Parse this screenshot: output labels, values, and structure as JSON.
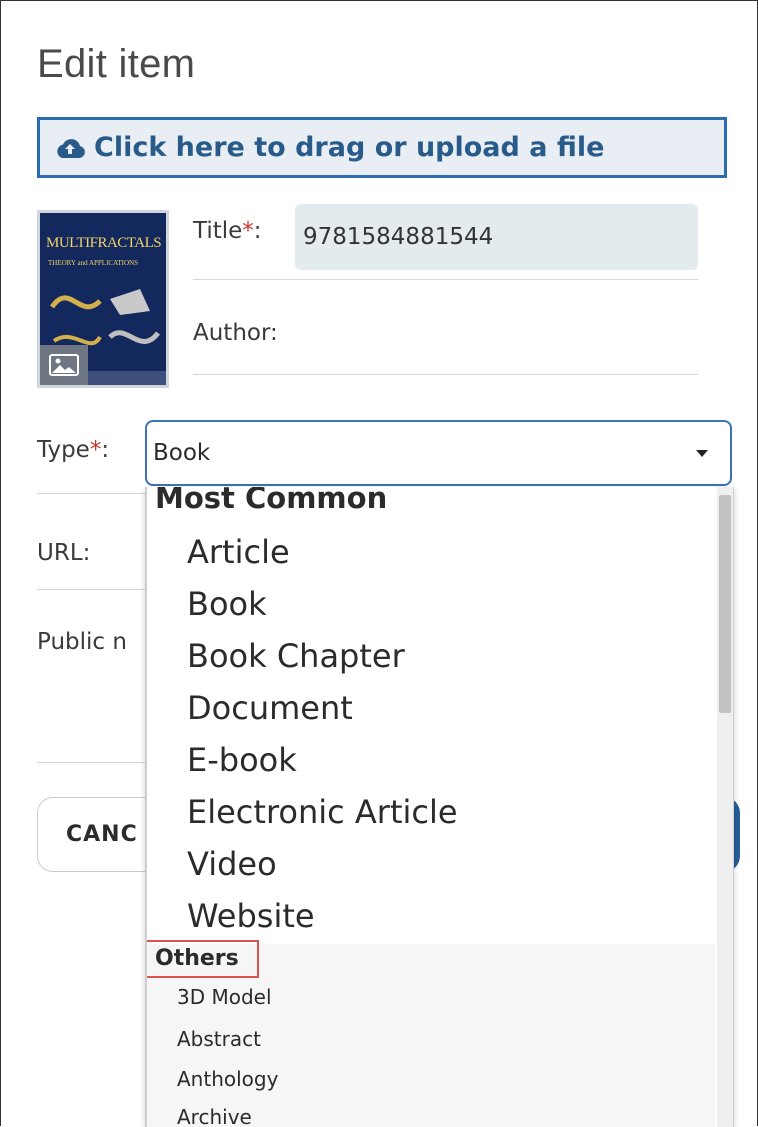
{
  "page": {
    "title": "Edit item"
  },
  "upload": {
    "label": "Click here to drag or upload a file",
    "icon": "cloud-upload-icon"
  },
  "cover": {
    "title_line": "MULTIFRACTALS",
    "subtitle_line": "THEORY and APPLICATIONS",
    "icon": "image-icon"
  },
  "fields": {
    "title_label": "Title",
    "title_value": "9781584881544",
    "author_label": "Author:",
    "type_label": "Type",
    "type_value": "Book",
    "url_label": "URL:",
    "public_note_label": "Public n",
    "required_mark": "*",
    "colon": ":"
  },
  "buttons": {
    "cancel": "CANC"
  },
  "dropdown": {
    "group_common": "Most Common",
    "common_items": [
      "Article",
      "Book",
      "Book Chapter",
      "Document",
      "E-book",
      "Electronic Article",
      "Video",
      "Website"
    ],
    "group_others": "Others",
    "other_items": [
      "3D Model",
      "Abstract",
      "Anthology",
      "Archive"
    ]
  },
  "colors": {
    "accent": "#2b6cb0",
    "required": "#c0392b",
    "highlight_box": "#d9534f"
  }
}
